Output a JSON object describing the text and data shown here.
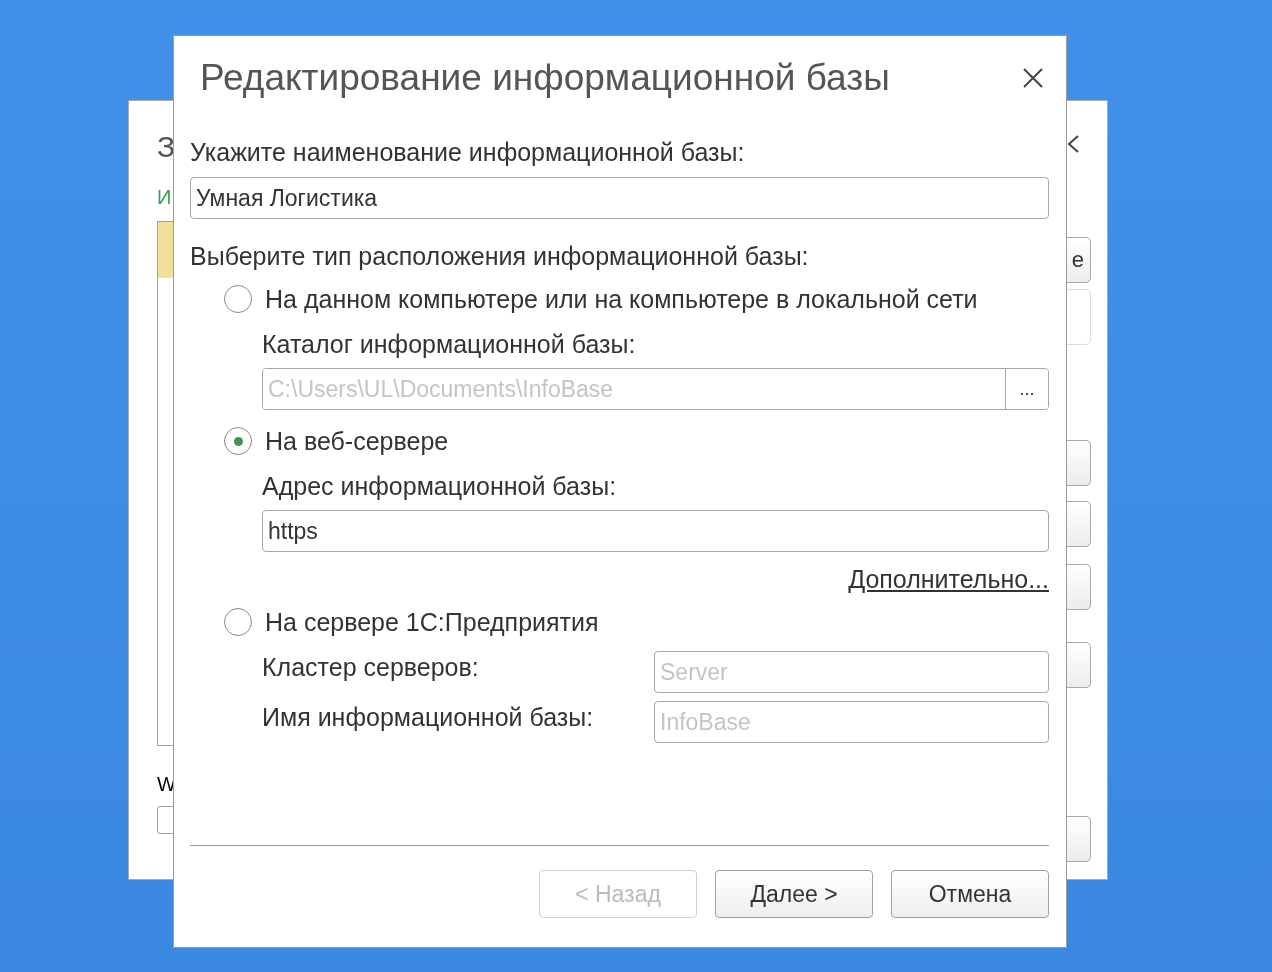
{
  "background_window": {
    "title": "З",
    "link": "И",
    "list_rows": [
      {
        "selected": true
      }
    ],
    "bottom_label": "W",
    "buttons": [
      {
        "disabled": false,
        "text": "е"
      },
      {
        "disabled": true
      },
      {
        "disabled": false
      },
      {
        "disabled": false
      },
      {
        "disabled": false
      },
      {
        "disabled": false
      },
      {
        "disabled": false
      }
    ]
  },
  "dialog": {
    "title": "Редактирование информационной базы",
    "name_label": "Укажите наименование информационной базы:",
    "name_value": "Умная Логистика",
    "location_label": "Выберите тип расположения информационной базы:",
    "options": [
      {
        "kind": "local",
        "label": "На данном компьютере или на компьютере в локальной сети",
        "selected": false,
        "field_label": "Каталог информационной базы:",
        "placeholder": "C:\\Users\\UL\\Documents\\InfoBase",
        "browse": "..."
      },
      {
        "kind": "web",
        "label": "На веб-сервере",
        "selected": true,
        "field_label": "Адрес информационной базы:",
        "value": "https",
        "link": "Дополнительно..."
      },
      {
        "kind": "server",
        "label": "На сервере 1С:Предприятия",
        "selected": false,
        "fields": [
          {
            "label": "Кластер серверов:",
            "placeholder": "Server"
          },
          {
            "label": "Имя информационной базы:",
            "placeholder": "InfoBase"
          }
        ]
      }
    ],
    "buttons": [
      {
        "label": "< Назад",
        "disabled": true
      },
      {
        "label": "Далее >",
        "disabled": false
      },
      {
        "label": "Отмена",
        "disabled": false
      }
    ]
  }
}
